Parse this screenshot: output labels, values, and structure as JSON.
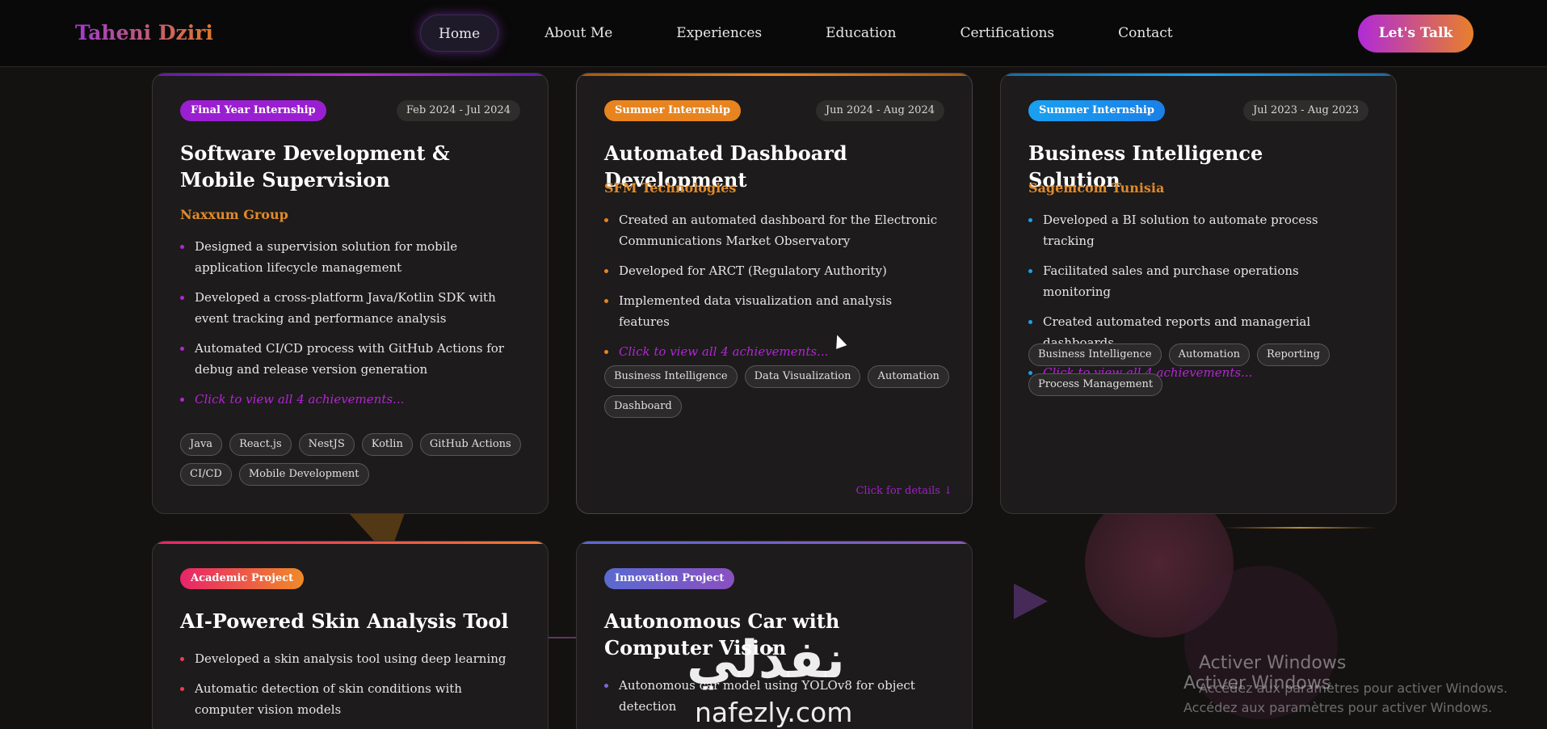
{
  "nav": {
    "brand": "Taheni Dziri",
    "links": [
      "Home",
      "About Me",
      "Experiences",
      "Education",
      "Certifications",
      "Contact"
    ],
    "active": "Home",
    "cta": "Let's Talk"
  },
  "cards": [
    {
      "badge": "Final Year Internship",
      "date": "Feb 2024 - Jul 2024",
      "title": "Software Development & Mobile Supervision",
      "company": "Naxxum Group",
      "bullets": [
        "Designed a supervision solution for mobile application lifecycle management",
        "Developed a cross-platform Java/Kotlin SDK with event tracking and performance analysis",
        "Automated CI/CD process with GitHub Actions for debug and release version generation"
      ],
      "more": "Click to view all 4 achievements...",
      "tags": [
        "Java",
        "React.js",
        "NestJS",
        "Kotlin",
        "GitHub Actions",
        "CI/CD",
        "Mobile Development"
      ]
    },
    {
      "badge": "Summer Internship",
      "date": "Jun 2024 - Aug 2024",
      "title": "Automated Dashboard Development",
      "company": "SFM Technologies",
      "bullets": [
        "Created an automated dashboard for the Electronic Communications Market Observatory",
        "Developed for ARCT (Regulatory Authority)",
        "Implemented data visualization and analysis features"
      ],
      "more": "Click to view all 4 achievements...",
      "tags": [
        "Business Intelligence",
        "Data Visualization",
        "Automation",
        "Dashboard"
      ],
      "details": "Click for details ↓"
    },
    {
      "badge": "Summer Internship",
      "date": "Jul 2023 - Aug 2023",
      "title": "Business Intelligence Solution",
      "company": "Sagemcom Tunisia",
      "bullets": [
        "Developed a BI solution to automate process tracking",
        "Facilitated sales and purchase operations monitoring",
        "Created automated reports and managerial dashboards"
      ],
      "more": "Click to view all 4 achievements...",
      "tags": [
        "Business Intelligence",
        "Automation",
        "Reporting",
        "Process Management"
      ]
    },
    {
      "badge": "Academic Project",
      "title": "AI-Powered Skin Analysis Tool",
      "bullets": [
        "Developed a skin analysis tool using deep learning",
        "Automatic detection of skin conditions with computer vision models"
      ]
    },
    {
      "badge": "Innovation Project",
      "title": "Autonomous Car with Computer Vision",
      "bullets": [
        "Autonomous car model using YOLOv8 for object detection"
      ]
    }
  ],
  "colors": {
    "purple": "#9a1fd0",
    "orange": "#e8841f",
    "blue": "#1aa0f0",
    "pink": "#e8246a",
    "indigo": "#6a6ad0"
  },
  "watermark": {
    "line1": "Activer Windows",
    "line2": "Accédez aux paramètres pour activer Windows."
  },
  "overlay_logo": {
    "arabic": "نفذلي",
    "latin": "nafezly.com"
  }
}
